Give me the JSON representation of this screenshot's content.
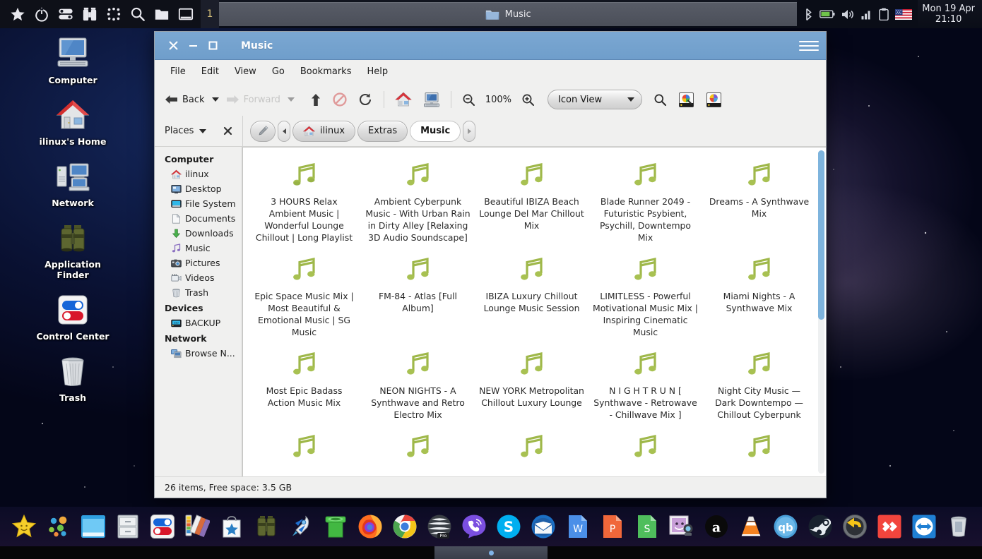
{
  "panel": {
    "launchers": [
      {
        "name": "favorites-icon",
        "glyph": "star"
      },
      {
        "name": "power-icon",
        "glyph": "power"
      },
      {
        "name": "settings-toggle-icon",
        "glyph": "toggle"
      },
      {
        "name": "application-finder-icon",
        "glyph": "binoculars"
      },
      {
        "name": "app-grid-icon",
        "glyph": "grid"
      },
      {
        "name": "search-icon",
        "glyph": "search"
      },
      {
        "name": "file-manager-icon",
        "glyph": "folder"
      },
      {
        "name": "show-desktop-icon",
        "glyph": "window"
      }
    ],
    "workspace": "1",
    "task": {
      "title": "Music",
      "icon": "folder-icon"
    },
    "tray": [
      {
        "name": "bluetooth-icon"
      },
      {
        "name": "battery-icon"
      },
      {
        "name": "volume-icon"
      },
      {
        "name": "network-signal-icon"
      },
      {
        "name": "clipboard-icon"
      },
      {
        "name": "keyboard-layout-flag-icon"
      }
    ],
    "clock": {
      "date": "Mon 19 Apr",
      "time": "21:10"
    }
  },
  "desktop_icons": [
    {
      "label": "Computer",
      "icon": "computer-icon"
    },
    {
      "label": "ilinux's Home",
      "icon": "home-icon"
    },
    {
      "label": "Network",
      "icon": "network-icon"
    },
    {
      "label": "Application Finder",
      "icon": "binoculars-icon"
    },
    {
      "label": "Control Center",
      "icon": "control-center-icon"
    },
    {
      "label": "Trash",
      "icon": "trash-icon"
    }
  ],
  "window": {
    "title": "Music",
    "controls": {
      "close": "close-icon",
      "minimize": "minimize-icon",
      "maximize": "maximize-icon",
      "menu": "hamburger-icon"
    },
    "menubar": [
      "File",
      "Edit",
      "View",
      "Go",
      "Bookmarks",
      "Help"
    ],
    "toolbar": {
      "back_label": "Back",
      "forward_label": "Forward",
      "up_name": "up-icon",
      "stop_name": "stop-icon",
      "reload_name": "reload-icon",
      "home_name": "home-icon",
      "computer_name": "computer-icon",
      "zoom_out_name": "zoom-out-icon",
      "zoom_level": "100%",
      "zoom_in_name": "zoom-in-icon",
      "view_mode": "Icon View",
      "search_name": "search-icon",
      "preview_name": "image-preview-icon",
      "colorpicker_name": "color-tool-icon"
    },
    "places": {
      "label": "Places",
      "close_name": "close-sidebar-icon"
    },
    "pathbar": {
      "edit_name": "edit-path-icon",
      "crumbs": [
        "ilinux",
        "Extras",
        "Music"
      ],
      "current": "Music"
    },
    "sidebar": [
      {
        "type": "group",
        "label": "Computer"
      },
      {
        "type": "item",
        "label": "ilinux",
        "icon": "home-icon"
      },
      {
        "type": "item",
        "label": "Desktop",
        "icon": "desktop-icon"
      },
      {
        "type": "item",
        "label": "File System",
        "icon": "filesystem-icon"
      },
      {
        "type": "item",
        "label": "Documents",
        "icon": "documents-icon"
      },
      {
        "type": "item",
        "label": "Downloads",
        "icon": "downloads-icon"
      },
      {
        "type": "item",
        "label": "Music",
        "icon": "music-icon"
      },
      {
        "type": "item",
        "label": "Pictures",
        "icon": "pictures-icon"
      },
      {
        "type": "item",
        "label": "Videos",
        "icon": "videos-icon"
      },
      {
        "type": "item",
        "label": "Trash",
        "icon": "trash-icon"
      },
      {
        "type": "group",
        "label": "Devices"
      },
      {
        "type": "item",
        "label": "BACKUP",
        "icon": "drive-icon"
      },
      {
        "type": "group",
        "label": "Network"
      },
      {
        "type": "item",
        "label": "Browse N...",
        "icon": "network-browse-icon"
      }
    ],
    "files": [
      "3 HOURS Relax Ambient Music | Wonderful Lounge Chillout | Long Playlist",
      "Ambient Cyberpunk Music - With Urban Rain in Dirty Alley [Relaxing 3D Audio Soundscape]",
      "Beautiful IBIZA Beach Lounge Del Mar Chillout Mix",
      "Blade Runner 2049 - Futuristic Psybient, Psychill, Downtempo Mix",
      "Dreams - A Synthwave Mix",
      "Epic Space Music Mix | Most Beautiful & Emotional Music | SG Music",
      "FM-84 - Atlas [Full Album]",
      "IBIZA Luxury Chillout Lounge Music Session",
      "LIMITLESS - Powerful Motivational Music Mix | Inspiring Cinematic Music",
      "Miami Nights - A Synthwave Mix",
      "Most Epic Badass Action Music Mix",
      "NEON NIGHTS - A Synthwave and Retro Electro Mix",
      "NEW YORK Metropolitan Chillout Luxury Lounge",
      "N I G H T R U N [ Synthwave - Retrowave - Chillwave Mix ]",
      "Night City Music — Dark Downtempo — Chillout Cyberpunk",
      "",
      "",
      "",
      "",
      ""
    ],
    "statusbar": "26 items, Free space: 3.5 GB"
  },
  "dock": [
    {
      "name": "dock-star-app",
      "label": "Favorites"
    },
    {
      "name": "dock-app-menu",
      "label": "Applications"
    },
    {
      "name": "dock-window-manager",
      "label": "Windows"
    },
    {
      "name": "dock-file-cabinet",
      "label": "Archive"
    },
    {
      "name": "dock-control-center",
      "label": "Control Center"
    },
    {
      "name": "dock-color-palette",
      "label": "Theme"
    },
    {
      "name": "dock-software-store",
      "label": "Software"
    },
    {
      "name": "dock-binoculars",
      "label": "Finder"
    },
    {
      "name": "dock-rocket",
      "label": "Launcher"
    },
    {
      "name": "dock-terminal-pipe",
      "label": "Terminal"
    },
    {
      "name": "dock-firefox",
      "label": "Firefox"
    },
    {
      "name": "dock-chrome",
      "label": "Chrome"
    },
    {
      "name": "dock-opera-pro",
      "label": "Opera"
    },
    {
      "name": "dock-viber",
      "label": "Viber"
    },
    {
      "name": "dock-skype",
      "label": "Skype"
    },
    {
      "name": "dock-thunderbird",
      "label": "Thunderbird"
    },
    {
      "name": "dock-writer",
      "label": "Writer"
    },
    {
      "name": "dock-presentation",
      "label": "Impress"
    },
    {
      "name": "dock-spreadsheet",
      "label": "Calc"
    },
    {
      "name": "dock-webcam",
      "label": "Cheese"
    },
    {
      "name": "dock-audacious",
      "label": "Audacious"
    },
    {
      "name": "dock-vlc",
      "label": "VLC"
    },
    {
      "name": "dock-qbittorrent",
      "label": "qBittorrent"
    },
    {
      "name": "dock-steam",
      "label": "Steam"
    },
    {
      "name": "dock-timeshift",
      "label": "Timeshift"
    },
    {
      "name": "dock-anydesk",
      "label": "AnyDesk"
    },
    {
      "name": "dock-teamviewer",
      "label": "TeamViewer"
    },
    {
      "name": "dock-trash",
      "label": "Trash"
    }
  ]
}
